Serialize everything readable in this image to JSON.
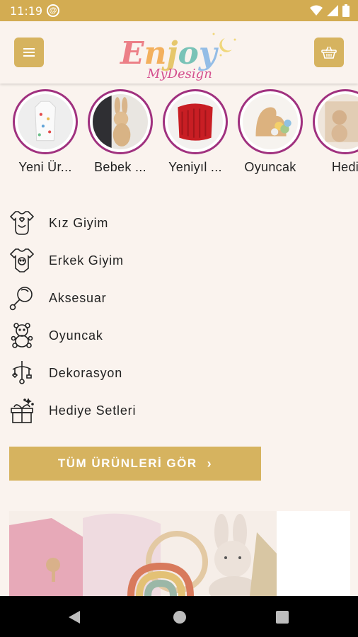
{
  "status_bar": {
    "time": "11:19",
    "icons": [
      "notification-icon",
      "wifi-icon",
      "signal-icon",
      "battery-icon"
    ]
  },
  "header": {
    "menu_icon": "hamburger-icon",
    "basket_icon": "basket-icon",
    "logo_line1": "Enjoy",
    "logo_line2": "MyDesign"
  },
  "stories": [
    {
      "label": "Yeni Ür..."
    },
    {
      "label": "Bebek ..."
    },
    {
      "label": "Yeniyıl ..."
    },
    {
      "label": "Oyuncak"
    },
    {
      "label": "Hedi"
    }
  ],
  "categories": [
    {
      "label": "Kız Giyim",
      "icon": "onesie-girl-icon"
    },
    {
      "label": "Erkek Giyim",
      "icon": "onesie-boy-icon"
    },
    {
      "label": "Aksesuar",
      "icon": "pacifier-icon"
    },
    {
      "label": "Oyuncak",
      "icon": "teddy-bear-icon"
    },
    {
      "label": "Dekorasyon",
      "icon": "crib-mobile-icon"
    },
    {
      "label": "Hediye Setleri",
      "icon": "gift-icon"
    }
  ],
  "all_products_button": {
    "label": "TÜM ÜRÜNLERİ GÖR",
    "chevron": "›"
  },
  "colors": {
    "accent": "#d6b35f",
    "status_bar": "#d3ac52",
    "ring": "#a0317f",
    "background": "#faf3ee"
  }
}
